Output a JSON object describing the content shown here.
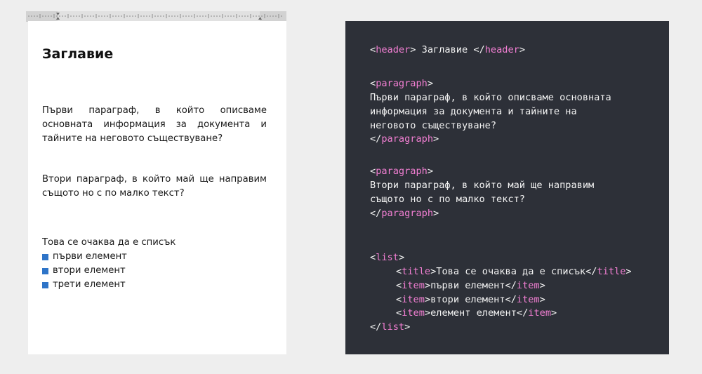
{
  "document": {
    "title": "Заглавие",
    "paragraph_1": "Първи параграф, в който описваме основната информация за документа и тайните на неговото съществуване?",
    "paragraph_2": "Втори параграф, в който май ще направим същото но с по малко текст?",
    "list_title": "Това се очаква да е списък",
    "list_items": [
      "първи елемент",
      "втори елемент",
      "трети елемент"
    ],
    "bullet_color": "#2e74c8"
  },
  "code": {
    "header_tag": "header",
    "header_text": " Заглавие ",
    "paragraph_tag": "paragraph",
    "paragraph_1_lines": [
      "Първи параграф, в който описваме основната",
      "информация за документа и тайните на",
      "неговото съществуване?"
    ],
    "paragraph_2_lines": [
      "Втори параграф, в който май ще направим",
      "същото но с по малко текст?"
    ],
    "list_tag": "list",
    "title_tag": "title",
    "title_text": "Това се очаква да е списък",
    "item_tag": "item",
    "items": [
      "първи елемент",
      "втори елемент",
      "елемент елемент"
    ],
    "tag_color": "#f27fd3",
    "background": "#2d3038"
  }
}
